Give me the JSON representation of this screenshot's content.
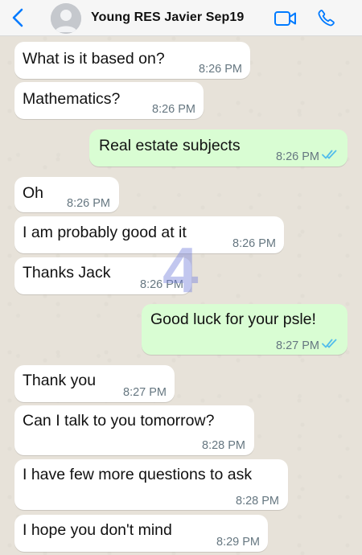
{
  "header": {
    "contact_name": "Young RES Javier Sep19",
    "accent_color": "#007aff"
  },
  "watermark": "4",
  "messages": [
    {
      "direction": "in",
      "text": "What is it based on?",
      "time": "8:26 PM"
    },
    {
      "direction": "in",
      "text": "Mathematics?",
      "time": "8:26 PM"
    },
    {
      "direction": "out",
      "text": "Real estate subjects",
      "time": "8:26 PM",
      "status": "read"
    },
    {
      "direction": "in",
      "text": "Oh",
      "time": "8:26 PM"
    },
    {
      "direction": "in",
      "text": "I am probably good at it",
      "time": "8:26 PM"
    },
    {
      "direction": "in",
      "text": "Thanks Jack",
      "time": "8:26 PM"
    },
    {
      "direction": "out",
      "text": "Good luck for your psle!",
      "time": "8:27 PM",
      "status": "read"
    },
    {
      "direction": "in",
      "text": "Thank you",
      "time": "8:27 PM"
    },
    {
      "direction": "in",
      "text": "Can I talk to you tomorrow?",
      "time": "8:28 PM"
    },
    {
      "direction": "in",
      "text": "I have few more questions to ask",
      "time": "8:28 PM"
    },
    {
      "direction": "in",
      "text": "I hope you don't mind",
      "time": "8:29 PM"
    }
  ],
  "colors": {
    "incoming_bubble": "#ffffff",
    "outgoing_bubble": "#d9fdd3",
    "read_ticks": "#53bdeb",
    "timestamp": "#667781"
  }
}
